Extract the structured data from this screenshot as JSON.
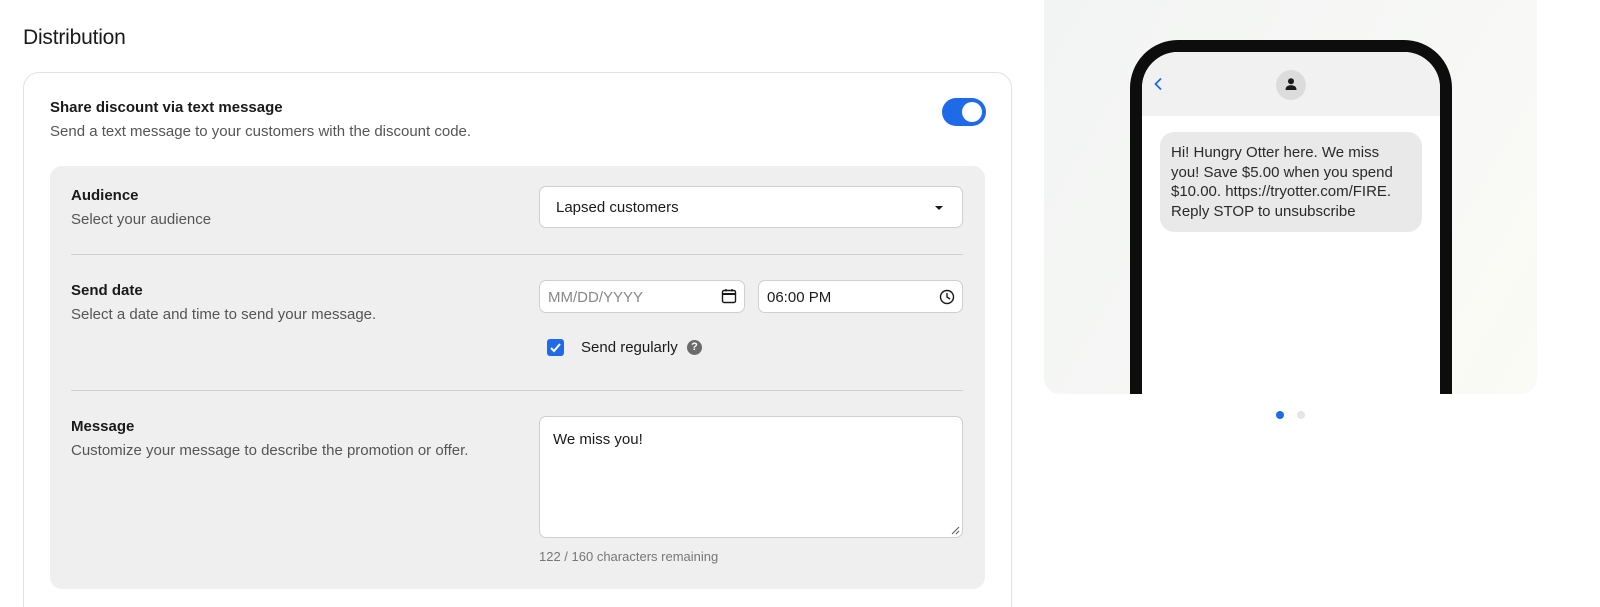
{
  "section": {
    "title": "Distribution"
  },
  "share": {
    "title": "Share discount via text message",
    "description": "Send a text message to your customers with the discount code.",
    "toggle_on": true
  },
  "audience": {
    "label": "Audience",
    "description": "Select your audience",
    "selected": "Lapsed customers"
  },
  "send_date": {
    "label": "Send date",
    "description": "Select a date and time to send your message.",
    "date_placeholder": "MM/DD/YYYY",
    "time_value": "06:00 PM",
    "recurring_checked": true,
    "recurring_label": "Send regularly"
  },
  "message": {
    "label": "Message",
    "description": "Customize your message to describe the promotion or offer.",
    "value": "We miss you!",
    "char_count": "122 / 160 characters remaining"
  },
  "preview": {
    "sms_text": "Hi! Hungry Otter here. We miss you! Save $5.00 when you spend $10.00. https://tryotter.com/FIRE. Reply STOP to unsubscribe",
    "pages": 2,
    "active_page": 1
  },
  "colors": {
    "accent": "#1f6ae8",
    "panel": "#efefef",
    "bubble": "#e9e9e9"
  }
}
